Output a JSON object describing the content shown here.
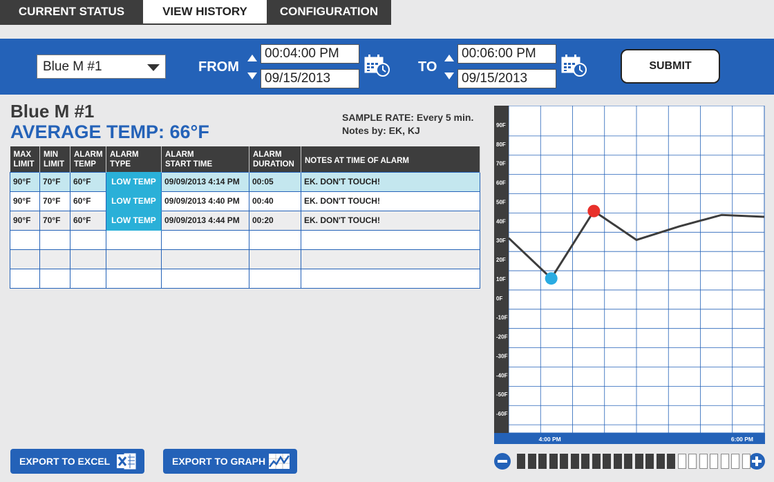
{
  "tabs": [
    {
      "label": "CURRENT STATUS"
    },
    {
      "label": "VIEW HISTORY"
    },
    {
      "label": "CONFIGURATION"
    }
  ],
  "filter": {
    "device": "Blue M #1",
    "from_label": "FROM",
    "from_time": "00:04:00 PM",
    "from_date": "09/15/2013",
    "to_label": "TO",
    "to_time": "00:06:00 PM",
    "to_date": "09/15/2013",
    "submit": "SUBMIT"
  },
  "info": {
    "device_title": "Blue M #1",
    "avg_temp": "AVERAGE TEMP: 66°F",
    "sample_rate": "SAMPLE RATE: Every 5 min.",
    "notes_by": "Notes by: EK, KJ"
  },
  "table": {
    "headers": [
      [
        "MAX",
        "LIMIT"
      ],
      [
        "MIN",
        "LIMIT"
      ],
      [
        "ALARM",
        "TEMP"
      ],
      [
        "ALARM",
        "TYPE"
      ],
      [
        "ALARM",
        "START TIME"
      ],
      [
        "ALARM",
        "DURATION"
      ],
      [
        "NOTES AT TIME OF ALARM",
        ""
      ]
    ],
    "rows": [
      {
        "max": "90°F",
        "min": "70°F",
        "temp": "60°F",
        "type": "LOW TEMP",
        "start": "09/09/2013  4:14 PM",
        "duration": "00:05",
        "notes": "EK. DON'T TOUCH!"
      },
      {
        "max": "90°F",
        "min": "70°F",
        "temp": "60°F",
        "type": "LOW TEMP",
        "start": "09/09/2013  4:40 PM",
        "duration": "00:40",
        "notes": "EK. DON'T TOUCH!"
      },
      {
        "max": "90°F",
        "min": "70°F",
        "temp": "60°F",
        "type": "LOW TEMP",
        "start": "09/09/2013  4:44 PM",
        "duration": "00:20",
        "notes": "EK. DON'T TOUCH!"
      }
    ]
  },
  "chart_data": {
    "type": "line",
    "ylim": [
      -70,
      100
    ],
    "y_ticks": [
      90,
      80,
      70,
      60,
      50,
      40,
      30,
      20,
      10,
      0,
      -10,
      -20,
      -30,
      -40,
      -50,
      -60
    ],
    "y_tick_labels": [
      "90F",
      "80F",
      "70F",
      "60F",
      "50F",
      "40F",
      "30F",
      "20F",
      "10F",
      "0F",
      "-10F",
      "-20F",
      "-30F",
      "-40F",
      "-50F",
      "-60F"
    ],
    "x_labels": [
      "4:00 PM",
      "6:00 PM"
    ],
    "grid": true,
    "points": [
      {
        "x": 0,
        "y": 37
      },
      {
        "x": 1,
        "y": 16
      },
      {
        "x": 2,
        "y": 51
      },
      {
        "x": 3,
        "y": 36
      },
      {
        "x": 4,
        "y": 43
      },
      {
        "x": 5,
        "y": 49
      },
      {
        "x": 6,
        "y": 48
      }
    ],
    "x_range": [
      0,
      6
    ],
    "markers": [
      {
        "index": 1,
        "color": "#29abe2"
      },
      {
        "index": 2,
        "color": "#e8302a"
      }
    ],
    "line_color": "#3d3d3d"
  },
  "export": {
    "excel": "EXPORT TO EXCEL",
    "graph": "EXPORT TO GRAPH"
  },
  "zoom": {
    "segments_total": 22,
    "segments_on": 15
  },
  "colors": {
    "accent": "#2462b8",
    "dark": "#3d3d3d",
    "alarm": "#2ab0d8",
    "highlight": "#c4e7ef"
  }
}
